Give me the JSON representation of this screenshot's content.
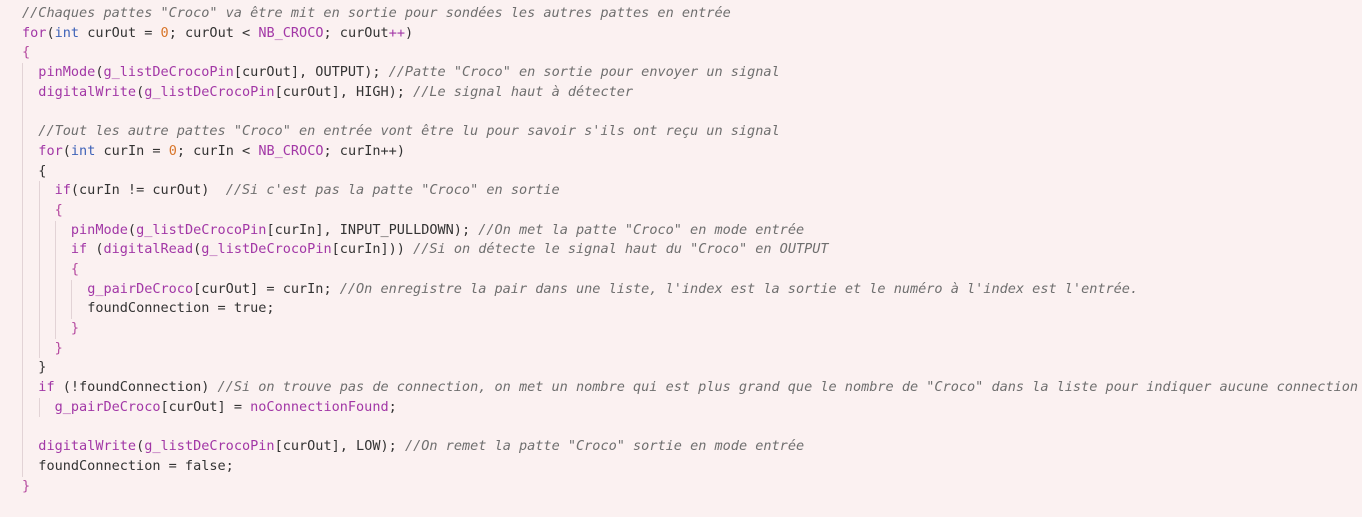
{
  "editor": {
    "lines": [
      {
        "indent": 0,
        "tokens": [
          {
            "c": "comment",
            "t": "//Chaques pattes \"Croco\" va être mit en sortie pour sondées les autres pattes en entrée"
          }
        ]
      },
      {
        "indent": 0,
        "tokens": [
          {
            "c": "keyword",
            "t": "for"
          },
          {
            "c": "plain",
            "t": "("
          },
          {
            "c": "type",
            "t": "int"
          },
          {
            "c": "plain",
            "t": " curOut = "
          },
          {
            "c": "num",
            "t": "0"
          },
          {
            "c": "plain",
            "t": "; curOut < "
          },
          {
            "c": "const",
            "t": "NB_CROCO"
          },
          {
            "c": "plain",
            "t": "; curOut"
          },
          {
            "c": "keyword",
            "t": "++"
          },
          {
            "c": "plain",
            "t": ")"
          }
        ]
      },
      {
        "indent": 0,
        "tokens": [
          {
            "c": "brace",
            "t": "{"
          }
        ]
      },
      {
        "indent": 1,
        "tokens": [
          {
            "c": "fn",
            "t": "pinMode"
          },
          {
            "c": "plain",
            "t": "("
          },
          {
            "c": "fn",
            "t": "g_listDeCrocoPin"
          },
          {
            "c": "plain",
            "t": "[curOut], OUTPUT); "
          },
          {
            "c": "comment",
            "t": "//Patte \"Croco\" en sortie pour envoyer un signal"
          }
        ]
      },
      {
        "indent": 1,
        "tokens": [
          {
            "c": "fn",
            "t": "digitalWrite"
          },
          {
            "c": "plain",
            "t": "("
          },
          {
            "c": "fn",
            "t": "g_listDeCrocoPin"
          },
          {
            "c": "plain",
            "t": "[curOut], HIGH); "
          },
          {
            "c": "comment",
            "t": "//Le signal haut à détecter"
          }
        ]
      },
      {
        "indent": 1,
        "tokens": []
      },
      {
        "indent": 1,
        "tokens": [
          {
            "c": "comment",
            "t": "//Tout les autre pattes \"Croco\" en entrée vont être lu pour savoir s'ils ont reçu un signal"
          }
        ]
      },
      {
        "indent": 1,
        "tokens": [
          {
            "c": "keyword",
            "t": "for"
          },
          {
            "c": "plain",
            "t": "("
          },
          {
            "c": "type",
            "t": "int"
          },
          {
            "c": "plain",
            "t": " curIn = "
          },
          {
            "c": "num",
            "t": "0"
          },
          {
            "c": "plain",
            "t": "; curIn < "
          },
          {
            "c": "const",
            "t": "NB_CROCO"
          },
          {
            "c": "plain",
            "t": "; curIn++)"
          }
        ]
      },
      {
        "indent": 1,
        "tokens": [
          {
            "c": "plain",
            "t": "{"
          }
        ]
      },
      {
        "indent": 2,
        "tokens": [
          {
            "c": "keyword",
            "t": "if"
          },
          {
            "c": "plain",
            "t": "(curIn != curOut)  "
          },
          {
            "c": "comment",
            "t": "//Si c'est pas la patte \"Croco\" en sortie"
          }
        ]
      },
      {
        "indent": 2,
        "tokens": [
          {
            "c": "brace",
            "t": "{"
          }
        ]
      },
      {
        "indent": 3,
        "tokens": [
          {
            "c": "fn",
            "t": "pinMode"
          },
          {
            "c": "plain",
            "t": "("
          },
          {
            "c": "fn",
            "t": "g_listDeCrocoPin"
          },
          {
            "c": "plain",
            "t": "[curIn], INPUT_PULLDOWN); "
          },
          {
            "c": "comment",
            "t": "//On met la patte \"Croco\" en mode entrée"
          }
        ]
      },
      {
        "indent": 3,
        "tokens": [
          {
            "c": "keyword",
            "t": "if"
          },
          {
            "c": "plain",
            "t": " ("
          },
          {
            "c": "fn",
            "t": "digitalRead"
          },
          {
            "c": "plain",
            "t": "("
          },
          {
            "c": "fn",
            "t": "g_listDeCrocoPin"
          },
          {
            "c": "plain",
            "t": "[curIn])) "
          },
          {
            "c": "comment",
            "t": "//Si on détecte le signal haut du \"Croco\" en OUTPUT"
          }
        ]
      },
      {
        "indent": 3,
        "tokens": [
          {
            "c": "brace",
            "t": "{"
          }
        ]
      },
      {
        "indent": 4,
        "tokens": [
          {
            "c": "fn",
            "t": "g_pairDeCroco"
          },
          {
            "c": "plain",
            "t": "[curOut] = curIn; "
          },
          {
            "c": "comment",
            "t": "//On enregistre la pair dans une liste, l'index est la sortie et le numéro à l'index est l'entrée."
          }
        ]
      },
      {
        "indent": 4,
        "tokens": [
          {
            "c": "plain",
            "t": "foundConnection = true;"
          }
        ]
      },
      {
        "indent": 3,
        "tokens": [
          {
            "c": "brace",
            "t": "}"
          }
        ]
      },
      {
        "indent": 2,
        "tokens": [
          {
            "c": "brace",
            "t": "}"
          }
        ]
      },
      {
        "indent": 1,
        "tokens": [
          {
            "c": "plain",
            "t": "}"
          }
        ]
      },
      {
        "indent": 1,
        "tokens": [
          {
            "c": "keyword",
            "t": "if"
          },
          {
            "c": "plain",
            "t": " (!foundConnection) "
          },
          {
            "c": "comment",
            "t": "//Si on trouve pas de connection, on met un nombre qui est plus grand que le nombre de \"Croco\" dans la liste pour indiquer aucune connection"
          }
        ]
      },
      {
        "indent": 2,
        "tokens": [
          {
            "c": "fn",
            "t": "g_pairDeCroco"
          },
          {
            "c": "plain",
            "t": "[curOut] = "
          },
          {
            "c": "fn",
            "t": "noConnectionFound"
          },
          {
            "c": "plain",
            "t": ";"
          }
        ]
      },
      {
        "indent": 1,
        "tokens": []
      },
      {
        "indent": 1,
        "tokens": [
          {
            "c": "fn",
            "t": "digitalWrite"
          },
          {
            "c": "plain",
            "t": "("
          },
          {
            "c": "fn",
            "t": "g_listDeCrocoPin"
          },
          {
            "c": "plain",
            "t": "[curOut], LOW); "
          },
          {
            "c": "comment",
            "t": "//On remet la patte \"Croco\" sortie en mode entrée"
          }
        ]
      },
      {
        "indent": 1,
        "tokens": [
          {
            "c": "plain",
            "t": "foundConnection = false;"
          }
        ]
      },
      {
        "indent": 0,
        "tokens": [
          {
            "c": "brace",
            "t": "}"
          }
        ]
      }
    ]
  }
}
